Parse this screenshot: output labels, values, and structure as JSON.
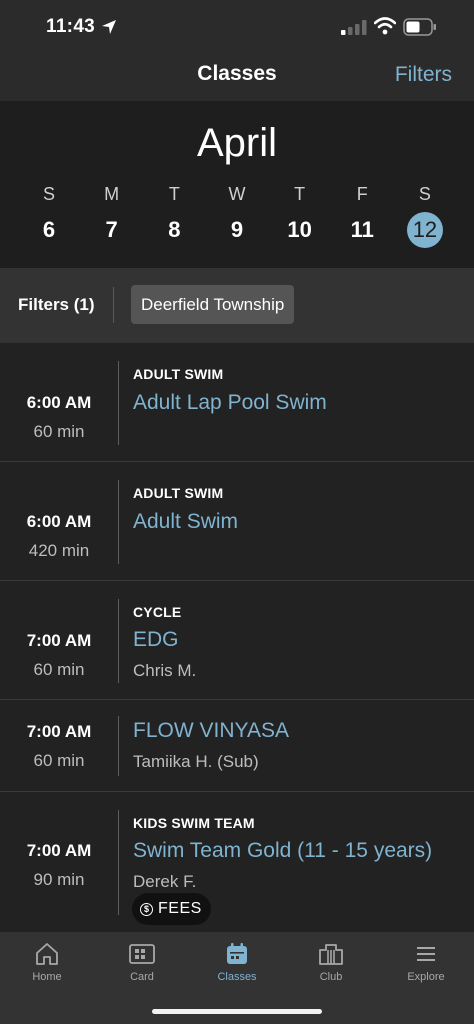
{
  "status_bar": {
    "time": "11:43"
  },
  "header": {
    "title": "Classes",
    "filters_label": "Filters"
  },
  "calendar": {
    "month": "April",
    "days": [
      {
        "letter": "S",
        "num": "6",
        "selected": false
      },
      {
        "letter": "M",
        "num": "7",
        "selected": false
      },
      {
        "letter": "T",
        "num": "8",
        "selected": false
      },
      {
        "letter": "W",
        "num": "9",
        "selected": false
      },
      {
        "letter": "T",
        "num": "10",
        "selected": false
      },
      {
        "letter": "F",
        "num": "11",
        "selected": false
      },
      {
        "letter": "S",
        "num": "12",
        "selected": true
      }
    ]
  },
  "filter_bar": {
    "count_label": "Filters (1)",
    "chip": "Deerfield Township"
  },
  "classes": [
    {
      "time": "6:00 AM",
      "duration": "60 min",
      "category": "ADULT SWIM",
      "name": "Adult Lap Pool Swim",
      "instructor": ""
    },
    {
      "time": "6:00 AM",
      "duration": "420 min",
      "category": "ADULT SWIM",
      "name": "Adult Swim",
      "instructor": ""
    },
    {
      "time": "7:00 AM",
      "duration": "60 min",
      "category": "CYCLE",
      "name": "EDG",
      "instructor": "Chris M."
    },
    {
      "time": "7:00 AM",
      "duration": "60 min",
      "category": "",
      "name": "FLOW VINYASA",
      "instructor": "Tamiika H. (Sub)"
    },
    {
      "time": "7:00 AM",
      "duration": "90 min",
      "category": "KIDS SWIM TEAM",
      "name": "Swim Team Gold  (11 - 15 years)",
      "instructor": "Derek F.",
      "fees_label": "FEES"
    }
  ],
  "tabs": [
    {
      "label": "Home",
      "icon": "home-icon",
      "active": false
    },
    {
      "label": "Card",
      "icon": "card-icon",
      "active": false
    },
    {
      "label": "Classes",
      "icon": "calendar-icon",
      "active": true
    },
    {
      "label": "Club",
      "icon": "club-icon",
      "active": false
    },
    {
      "label": "Explore",
      "icon": "menu-icon",
      "active": false
    }
  ],
  "colors": {
    "accent": "#7fb3cf",
    "background": "#222222",
    "filter_bar": "#333333"
  }
}
